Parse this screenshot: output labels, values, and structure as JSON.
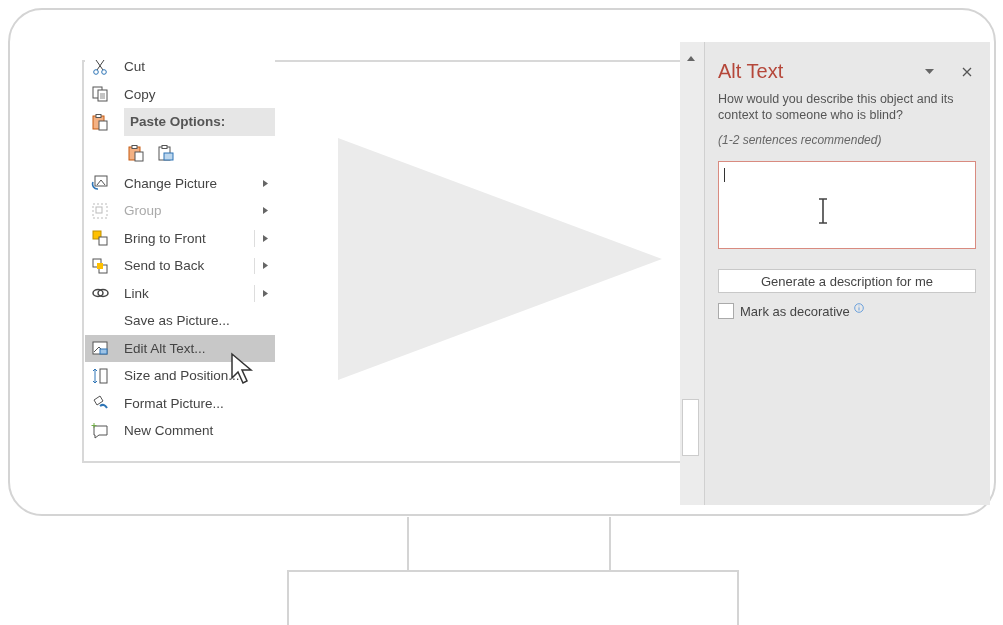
{
  "context_menu": {
    "items": [
      {
        "kind": "item",
        "label": "Cut",
        "disabled": false,
        "selected": false,
        "has_submenu": false,
        "split": false
      },
      {
        "kind": "item",
        "label": "Copy",
        "disabled": false,
        "selected": false,
        "has_submenu": false,
        "split": false
      },
      {
        "kind": "header",
        "label": "Paste Options:"
      },
      {
        "kind": "paste_icons"
      },
      {
        "kind": "item",
        "label": "Change Picture",
        "disabled": false,
        "selected": false,
        "has_submenu": true,
        "split": false
      },
      {
        "kind": "item",
        "label": "Group",
        "disabled": true,
        "selected": false,
        "has_submenu": true,
        "split": false
      },
      {
        "kind": "item",
        "label": "Bring to Front",
        "disabled": false,
        "selected": false,
        "has_submenu": true,
        "split": true
      },
      {
        "kind": "item",
        "label": "Send to Back",
        "disabled": false,
        "selected": false,
        "has_submenu": true,
        "split": true
      },
      {
        "kind": "item",
        "label": "Link",
        "disabled": false,
        "selected": false,
        "has_submenu": true,
        "split": true
      },
      {
        "kind": "item",
        "label": "Save as Picture...",
        "disabled": false,
        "selected": false,
        "has_submenu": false,
        "split": false
      },
      {
        "kind": "item",
        "label": "Edit Alt Text...",
        "disabled": false,
        "selected": true,
        "has_submenu": false,
        "split": false
      },
      {
        "kind": "item",
        "label": "Size and Position...",
        "disabled": false,
        "selected": false,
        "has_submenu": false,
        "split": false
      },
      {
        "kind": "item",
        "label": "Format Picture...",
        "disabled": false,
        "selected": false,
        "has_submenu": false,
        "split": false
      },
      {
        "kind": "item",
        "label": "New Comment",
        "disabled": false,
        "selected": false,
        "has_submenu": false,
        "split": false
      }
    ]
  },
  "alt_text_pane": {
    "title": "Alt Text",
    "question": "How would you describe this object and its context to someone who is blind?",
    "hint": "(1-2 sentences recommended)",
    "description_field": {
      "focused": true
    },
    "generate_button": "Generate a description for me",
    "decorative_checkbox": {
      "label": "Mark as decorative",
      "checked": false
    }
  }
}
